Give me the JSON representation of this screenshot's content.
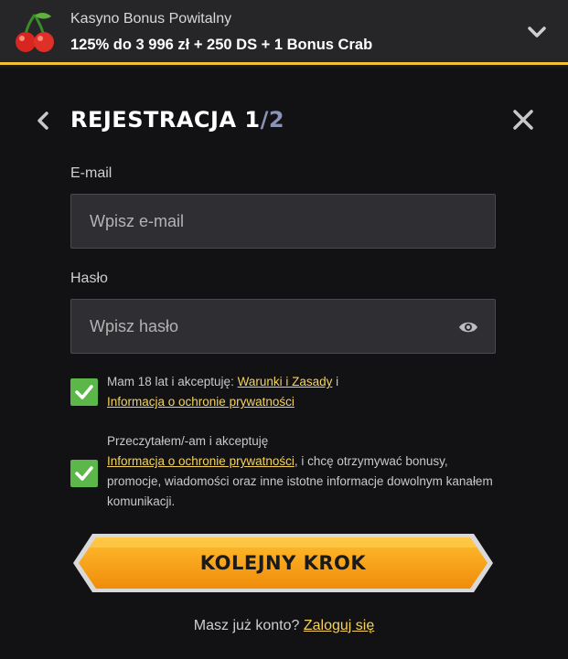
{
  "banner": {
    "title": "Kasyno Bonus Powitalny",
    "offer": "125% do 3 996 zł + 250 DS + 1 Bonus Crab"
  },
  "modal": {
    "title": "REJESTRACJA 1",
    "step_sep": "/",
    "step_total": "2"
  },
  "form": {
    "email_label": "E-mail",
    "email_placeholder": "Wpisz e-mail",
    "password_label": "Hasło",
    "password_placeholder": "Wpisz hasło"
  },
  "consent1": {
    "text_before": "Mam 18 lat i akceptuję: ",
    "link_terms": "Warunki i Zasady",
    "text_mid": " i",
    "link_privacy": "Informacja o ochronie prywatności",
    "checked": true
  },
  "consent2": {
    "text_before": "Przeczytałem/-am i akceptuję",
    "link_privacy": "Informacja o ochronie prywatności",
    "text_after": ", i chcę otrzymywać bonusy, promocje, wiadomości oraz inne istotne informacje dowolnym kanałem komunikacji.",
    "checked": true
  },
  "cta": {
    "label": "KOLEJNY KROK"
  },
  "login": {
    "prompt": "Masz już konto? ",
    "link": "Zaloguj się"
  },
  "colors": {
    "accent_yellow": "#f2c233",
    "link_yellow": "#f5d35a",
    "checkbox_green": "#5cb74a",
    "cta_orange": "#f5a514",
    "panel_bg": "#121214"
  },
  "icons": {
    "banner_logo": "cherries-icon",
    "expand": "chevron-down-icon",
    "back": "chevron-left-icon",
    "close": "close-icon",
    "password_toggle": "eye-icon",
    "checkbox": "checkmark-icon"
  }
}
